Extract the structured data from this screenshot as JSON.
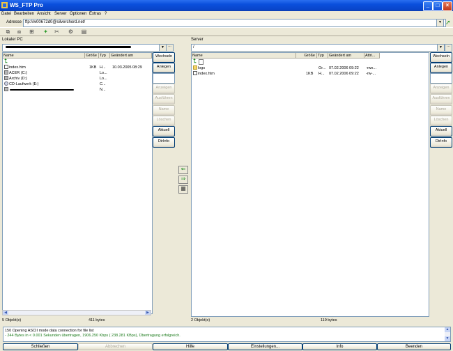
{
  "window": {
    "title": "WS_FTP Pro"
  },
  "menu": [
    "Datei",
    "Bearbeiten",
    "Ansicht",
    "Server",
    "Optionen",
    "Extras",
    "?"
  ],
  "address": {
    "label": "Adresse",
    "value": "ftp://w00672d0@silverchord.net/"
  },
  "toolbar_icons": [
    "connect-icon",
    "disconnect-icon",
    "site-manager-icon",
    "plugin-icon",
    "tools-icon",
    "options-icon",
    "view-icon"
  ],
  "local": {
    "caption": "Lokaler PC",
    "path": "",
    "columns": [
      "Name",
      "Größe",
      "Typ",
      "Geändert am"
    ],
    "rows": [
      {
        "name": "index.htm",
        "size": "1KB",
        "type": "H...",
        "date": "10.03.2005 08:29",
        "icon": "file"
      },
      {
        "name": "ACER (C:)",
        "size": "",
        "type": "Lo...",
        "date": "",
        "icon": "drive"
      },
      {
        "name": "Archiv (D:)",
        "size": "",
        "type": "Lo...",
        "date": "",
        "icon": "drive"
      },
      {
        "name": "CD-Laufwerk (E:)",
        "size": "",
        "type": "C...",
        "date": "",
        "icon": "cd"
      },
      {
        "name": "",
        "size": "",
        "type": "N...",
        "date": "",
        "icon": "drive"
      }
    ],
    "buttons": [
      "Wechseln",
      "Anlegen",
      "Anzeigen",
      "Ausführen",
      "Name",
      "Löschen",
      "Aktuell",
      "DirInfo"
    ],
    "status_count": "5 Objekt(e)",
    "status_size": "411 bytes"
  },
  "remote": {
    "caption": "Server",
    "path": "/",
    "columns": [
      "Name",
      "Größe",
      "Typ",
      "Geändert am",
      "Attri..."
    ],
    "rows": [
      {
        "name": "logs",
        "size": "",
        "type": "Or...",
        "date": "07.02.2006 09:22",
        "attr": "-rwx...",
        "icon": "folder"
      },
      {
        "name": "index.htm",
        "size": "1KB",
        "type": "H...",
        "date": "07.02.2006 09:22",
        "attr": "-rw-...",
        "icon": "file"
      }
    ],
    "buttons": [
      "Wechseln",
      "Anlegen",
      "Anzeigen",
      "Ausführen",
      "Name",
      "Löschen",
      "Aktuell",
      "DirInfo"
    ],
    "status_count": "2 Objekt(e)",
    "status_size": "119 bytes"
  },
  "log": {
    "line1": "150 Opening ASCII mode data connection for file list",
    "line2": "- 244 Bytes in < 0.001 Sekunden übertragen, 1906.250 Kbps ( 238.281 KBps), Übertragung erfolgreich."
  },
  "bottom": {
    "close": "Schließen",
    "cancel": "Abbrechen",
    "help": "Hilfe",
    "settings": "Einstellungen...",
    "info": "Info",
    "exit": "Beenden"
  }
}
